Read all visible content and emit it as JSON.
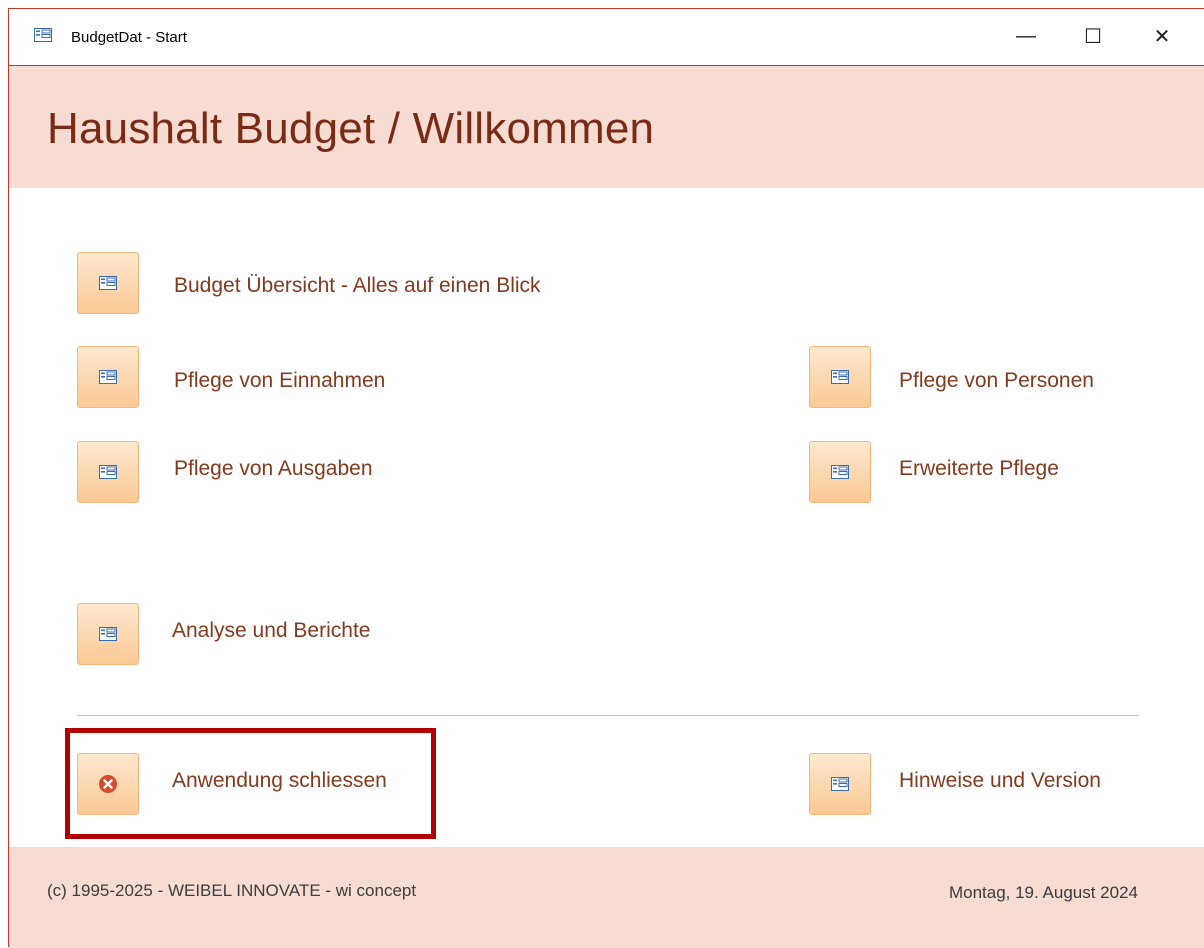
{
  "window": {
    "title": "BudgetDat - Start",
    "minimize": "—",
    "maximize": "☐",
    "close": "✕"
  },
  "header": {
    "title": "Haushalt Budget / Willkommen"
  },
  "menu": {
    "overview": "Budget Übersicht - Alles auf einen Blick",
    "income": "Pflege von Einnahmen",
    "expenses": "Pflege von Ausgaben",
    "persons": "Pflege von Personen",
    "extended": "Erweiterte Pflege",
    "analysis": "Analyse und Berichte",
    "close_app": "Anwendung schliessen",
    "info": "Hinweise und Version"
  },
  "footer": {
    "copyright": "(c) 1995-2025 - WEIBEL INNOVATE - wi concept",
    "date": "Montag, 19. August 2024"
  },
  "colors": {
    "accent_bg": "#f6dcd2",
    "label_text": "#843a1f",
    "button_border": "#f4b87e",
    "highlight": "#b00000",
    "close_icon": "#d64a2e"
  },
  "icons": {
    "form": "form-icon",
    "close": "close-circle-icon"
  }
}
